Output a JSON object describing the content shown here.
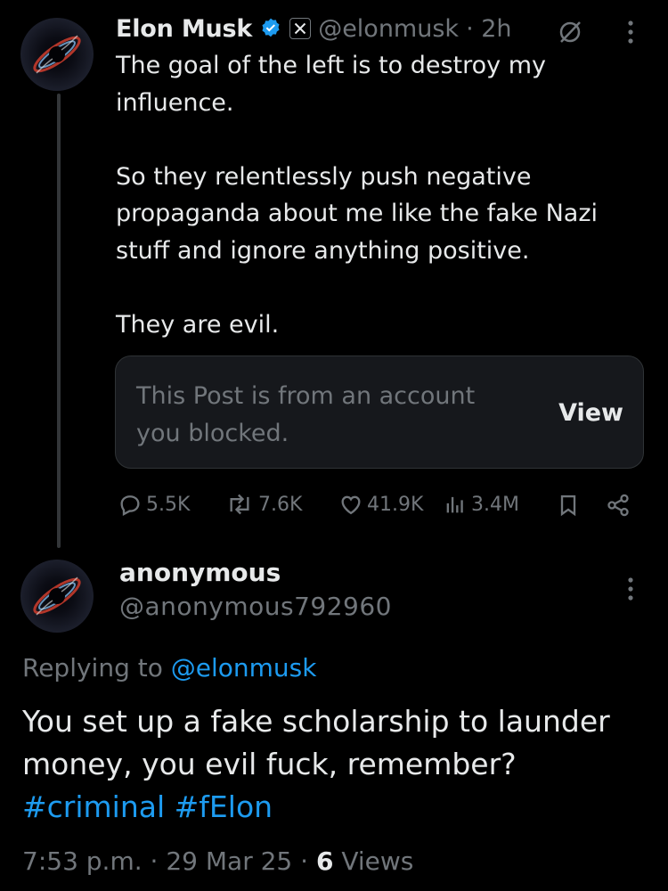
{
  "parent": {
    "name": "Elon Musk",
    "handle": "@elonmusk",
    "time": "· 2h",
    "text": "The goal of the left is to destroy my influence.\n\nSo they relentlessly push negative propaganda about me like the fake Nazi stuff and ignore anything positive.\n\nThey are evil.",
    "blocked_card": {
      "text": "This Post is from an account you blocked.",
      "button": "View"
    },
    "stats": {
      "replies": "5.5K",
      "reposts": "7.6K",
      "likes": "41.9K",
      "views": "3.4M"
    },
    "icons": [
      "verified-badge-icon",
      "x-logo-icon",
      "grok-icon",
      "more-icon",
      "reply-icon",
      "repost-icon",
      "like-icon",
      "views-icon",
      "bookmark-icon",
      "share-icon"
    ]
  },
  "reply": {
    "name": "anonymous",
    "handle": "@anonymous792960",
    "replying_prefix": "Replying to",
    "replying_handle": "@elonmusk",
    "text": "You set up a fake scholarship to launder money, you evil fuck, remember?",
    "hashtags": [
      "#criminal",
      "#fElon"
    ],
    "time": "7:53 p.m.",
    "date": "29 Mar 25",
    "views_count": "6",
    "views_label": "Views"
  },
  "colors": {
    "background": "#000000",
    "text": "#e7e9ea",
    "secondary": "#71767b",
    "link": "#1d9bf0",
    "card": "#16181c"
  }
}
